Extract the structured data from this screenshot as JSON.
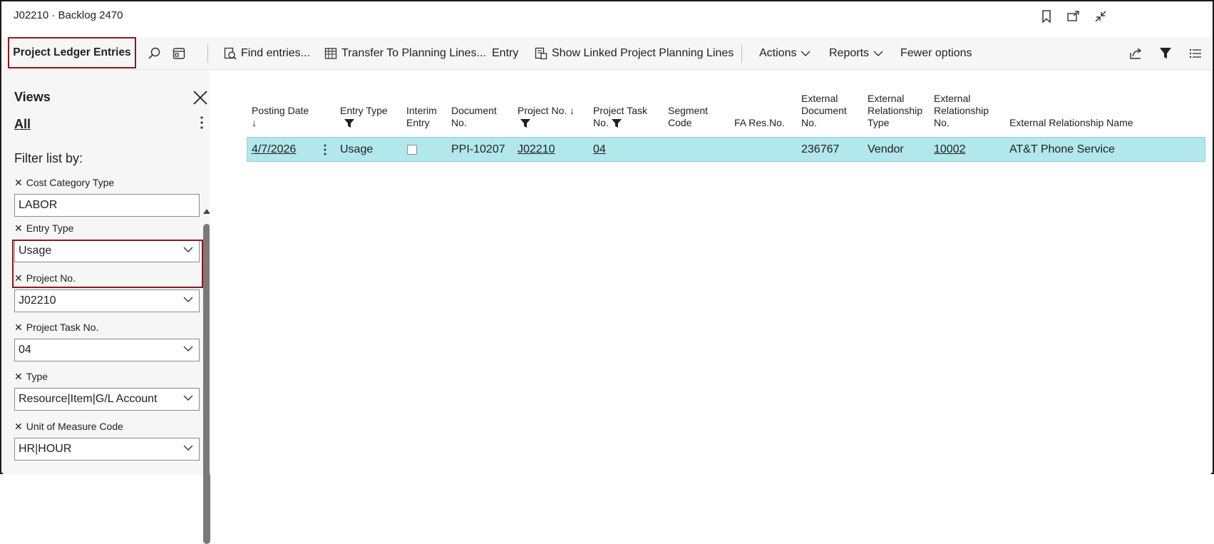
{
  "window": {
    "title": "J02210 · Backlog 2470"
  },
  "actionbar": {
    "page_caption": "Project Ledger Entries",
    "find_entries": "Find entries...",
    "transfer": "Transfer To Planning Lines...",
    "entry": "Entry",
    "show_linked": "Show Linked Project Planning Lines",
    "actions": "Actions",
    "reports": "Reports",
    "fewer_options": "Fewer options"
  },
  "filterpane": {
    "views_title": "Views",
    "views_all": "All",
    "filter_by": "Filter list by:",
    "filters": [
      {
        "label": "Cost Category Type",
        "value": "LABOR"
      },
      {
        "label": "Entry Type",
        "value": "Usage"
      },
      {
        "label": "Project No.",
        "value": "J02210"
      },
      {
        "label": "Project Task No.",
        "value": "04"
      },
      {
        "label": "Type",
        "value": "Resource|Item|G/L Account"
      },
      {
        "label": "Unit of Measure Code",
        "value": "HR|HOUR"
      }
    ]
  },
  "grid": {
    "headers": {
      "posting_date_1": "Posting Date",
      "posting_date_2": "↓",
      "entry_type": "Entry Type",
      "interim_1": "Interim",
      "interim_2": "Entry",
      "document_1": "Document",
      "document_2": "No.",
      "project_no": "Project No. ↓",
      "project_task_1": "Project Task",
      "project_task_2": "No.",
      "segment_1": "Segment",
      "segment_2": "Code",
      "fa_res": "FA Res.No.",
      "ext_doc_1": "External",
      "ext_doc_2": "Document",
      "ext_doc_3": "No.",
      "ext_rel_type_1": "External",
      "ext_rel_type_2": "Relationship",
      "ext_rel_type_3": "Type",
      "ext_rel_no_1": "External",
      "ext_rel_no_2": "Relationship",
      "ext_rel_no_3": "No.",
      "ext_rel_name": "External Relationship Name"
    },
    "rows": [
      {
        "posting_date": "4/7/2026",
        "entry_type": "Usage",
        "interim_entry": false,
        "document_no": "PPI-10207",
        "project_no": "J02210",
        "project_task_no": "04",
        "segment_code": "",
        "fa_res_no": "",
        "external_document_no": "236767",
        "external_relationship_type": "Vendor",
        "external_relationship_no": "10002",
        "external_relationship_name": "AT&T Phone Service"
      }
    ]
  },
  "colors": {
    "selected_row": "#b2e7ec",
    "highlight_border": "#8b1a1a"
  }
}
